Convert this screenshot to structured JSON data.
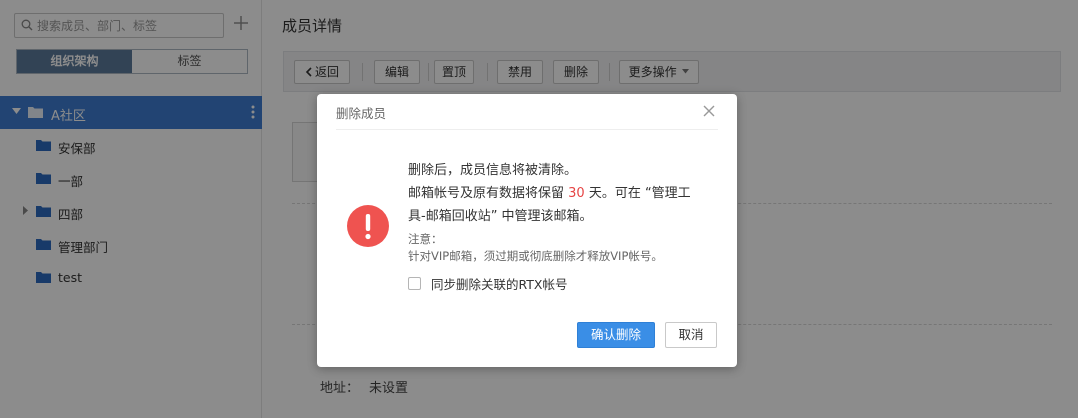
{
  "sidebar": {
    "search_placeholder": "搜索成员、部门、标签",
    "add_icon": "plus-icon",
    "segments": [
      {
        "label": "组织架构",
        "active": true
      },
      {
        "label": "标签",
        "active": false
      }
    ],
    "root": {
      "label": "A社区",
      "icon": "folder-icon"
    },
    "items": [
      {
        "label": "安保部",
        "has_children": false
      },
      {
        "label": "一部",
        "has_children": false
      },
      {
        "label": "四部",
        "has_children": true
      },
      {
        "label": "管理部门",
        "has_children": false
      },
      {
        "label": "test",
        "has_children": false
      }
    ]
  },
  "main": {
    "title": "成员详情",
    "toolbar": {
      "back": "返回",
      "edit": "编辑",
      "pin": "置顶",
      "disable": "禁用",
      "delete": "删除",
      "more": "更多操作"
    },
    "address": {
      "label": "地址：",
      "value": "未设置"
    }
  },
  "modal": {
    "title": "删除成员",
    "line1": "删除后，成员信息将被清除。",
    "line2_before": "邮箱帐号及原有数据将保留 ",
    "line2_days": "30",
    "line2_after": " 天。可在 “管理工具-邮箱回收站” 中管理该邮箱。",
    "note_title": "注意：",
    "note_text": "针对VIP邮箱，须过期或彻底删除才释放VIP帐号。",
    "checkbox_label": "同步删除关联的RTX帐号",
    "checkbox_checked": false,
    "confirm": "确认删除",
    "cancel": "取消"
  },
  "colors": {
    "primary": "#3a8ee6",
    "tree_selected": "#3e7dd1",
    "warning": "#ef5350",
    "segment_active": "#5c7a9b",
    "days_highlight": "#e64545"
  }
}
